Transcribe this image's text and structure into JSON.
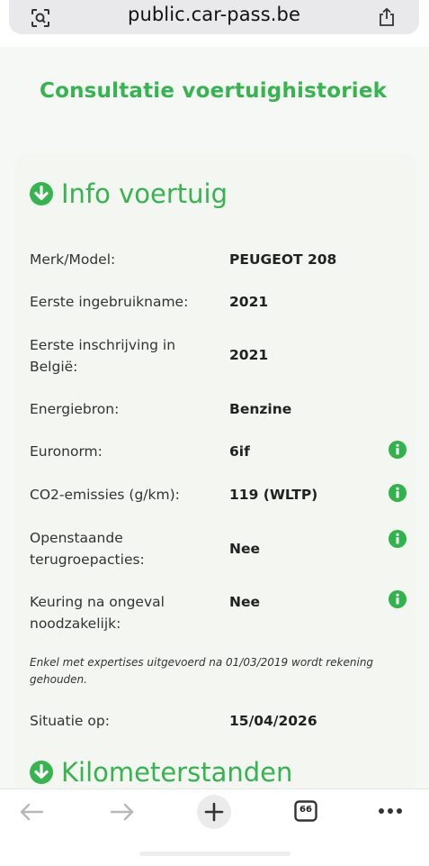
{
  "browser": {
    "url": "public.car-pass.be",
    "tabs_count": "66"
  },
  "page": {
    "title": "Consultatie voertuighistoriek"
  },
  "info_section": {
    "title": "Info voertuig",
    "rows": [
      {
        "label": "Merk/Model:",
        "value": "PEUGEOT 208"
      },
      {
        "label": "Eerste ingebruikname:",
        "value": "2021"
      },
      {
        "label": "Eerste inschrijving in België:",
        "value": "2021"
      },
      {
        "label": "Energiebron:",
        "value": "Benzine"
      },
      {
        "label": "Euronorm:",
        "value": "6if"
      },
      {
        "label": "CO2-emissies (g/km):",
        "value": "119 (WLTP)"
      },
      {
        "label": "Openstaande terugroepacties:",
        "value": "Nee"
      },
      {
        "label": "Keuring na ongeval noodzakelijk:",
        "value": "Nee"
      }
    ],
    "note": "Enkel met expertises uitgevoerd na 01/03/2019 wordt rekening gehouden.",
    "situation_label": "Situatie op:",
    "situation_value": "15/04/2026"
  },
  "km_section": {
    "title": "Kilometerstanden"
  },
  "colors": {
    "brand_green": "#35b450",
    "info_icon": "#2fb34a"
  }
}
